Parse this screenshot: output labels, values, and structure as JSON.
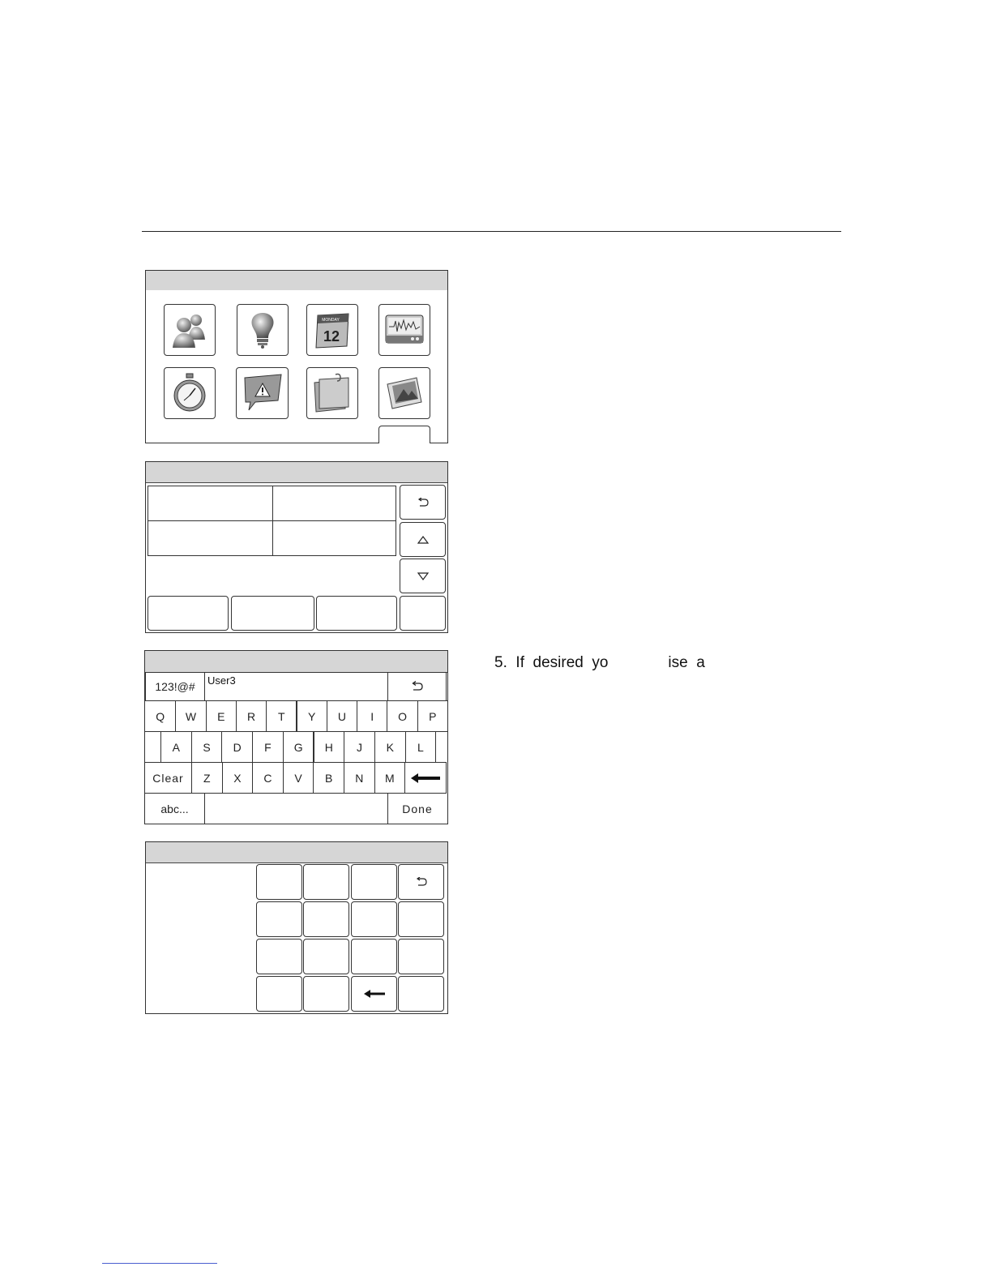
{
  "keyboard": {
    "mode_key": "123!@#",
    "input_value": "User3",
    "row1": [
      "Q",
      "W",
      "E",
      "R",
      "T",
      "Y",
      "U",
      "I",
      "O",
      "P"
    ],
    "row2": [
      "A",
      "S",
      "D",
      "F",
      "G",
      "H",
      "J",
      "K",
      "L"
    ],
    "row3": [
      "Z",
      "X",
      "C",
      "V",
      "B",
      "N",
      "M"
    ],
    "clear_key": "Clear",
    "abc_key": "abc...",
    "done_key": "Done"
  },
  "icons": [
    "users-icon",
    "lightbulb-icon",
    "calendar-icon",
    "waveform-monitor-icon",
    "stopwatch-icon",
    "alert-message-icon",
    "notes-icon",
    "picture-icon"
  ],
  "calendar_icon_text": {
    "day": "12",
    "month": "MONDAY"
  },
  "instruction": {
    "step": "5.",
    "text": "If  desired  yo              ise  a"
  }
}
